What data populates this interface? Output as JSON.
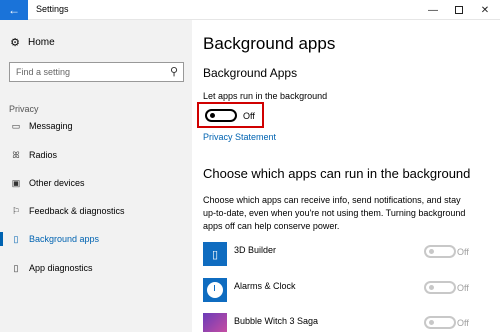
{
  "window": {
    "title": "Settings",
    "back_icon": "←",
    "minimize_icon": "—",
    "close_icon": "✕"
  },
  "sidebar": {
    "home_label": "Home",
    "home_icon": "⚙",
    "search_placeholder": "Find a setting",
    "search_icon": "⚲",
    "section_label": "Privacy",
    "items": [
      {
        "label": "Messaging",
        "icon": "▭"
      },
      {
        "label": "Radios",
        "icon": "ꕤ"
      },
      {
        "label": "Other devices",
        "icon": "▣"
      },
      {
        "label": "Feedback & diagnostics",
        "icon": "⚐"
      },
      {
        "label": "Background apps",
        "icon": "▯",
        "active": true
      },
      {
        "label": "App diagnostics",
        "icon": "▯"
      }
    ]
  },
  "main": {
    "page_title": "Background apps",
    "subtitle": "Background Apps",
    "toggle_label": "Let apps run in the background",
    "toggle_state": "Off",
    "privacy_link": "Privacy Statement",
    "section_heading": "Choose which apps can run in the background",
    "description": "Choose which apps can receive info, send notifications, and stay up-to-date, even when you're not using them. Turning background apps off can help conserve power.",
    "apps": [
      {
        "name": "3D Builder",
        "state": "Off",
        "icon": "3d-builder-icon"
      },
      {
        "name": "Alarms & Clock",
        "state": "Off",
        "icon": "alarms-clock-icon"
      },
      {
        "name": "Bubble Witch 3 Saga",
        "state": "Off",
        "icon": "bubble-witch-icon"
      }
    ]
  },
  "colors": {
    "accent": "#0063b1",
    "title_back": "#1a73d9",
    "highlight": "#d00000",
    "sidebar_bg": "#f2f2f2",
    "app_tile": "#0f6cc0"
  }
}
